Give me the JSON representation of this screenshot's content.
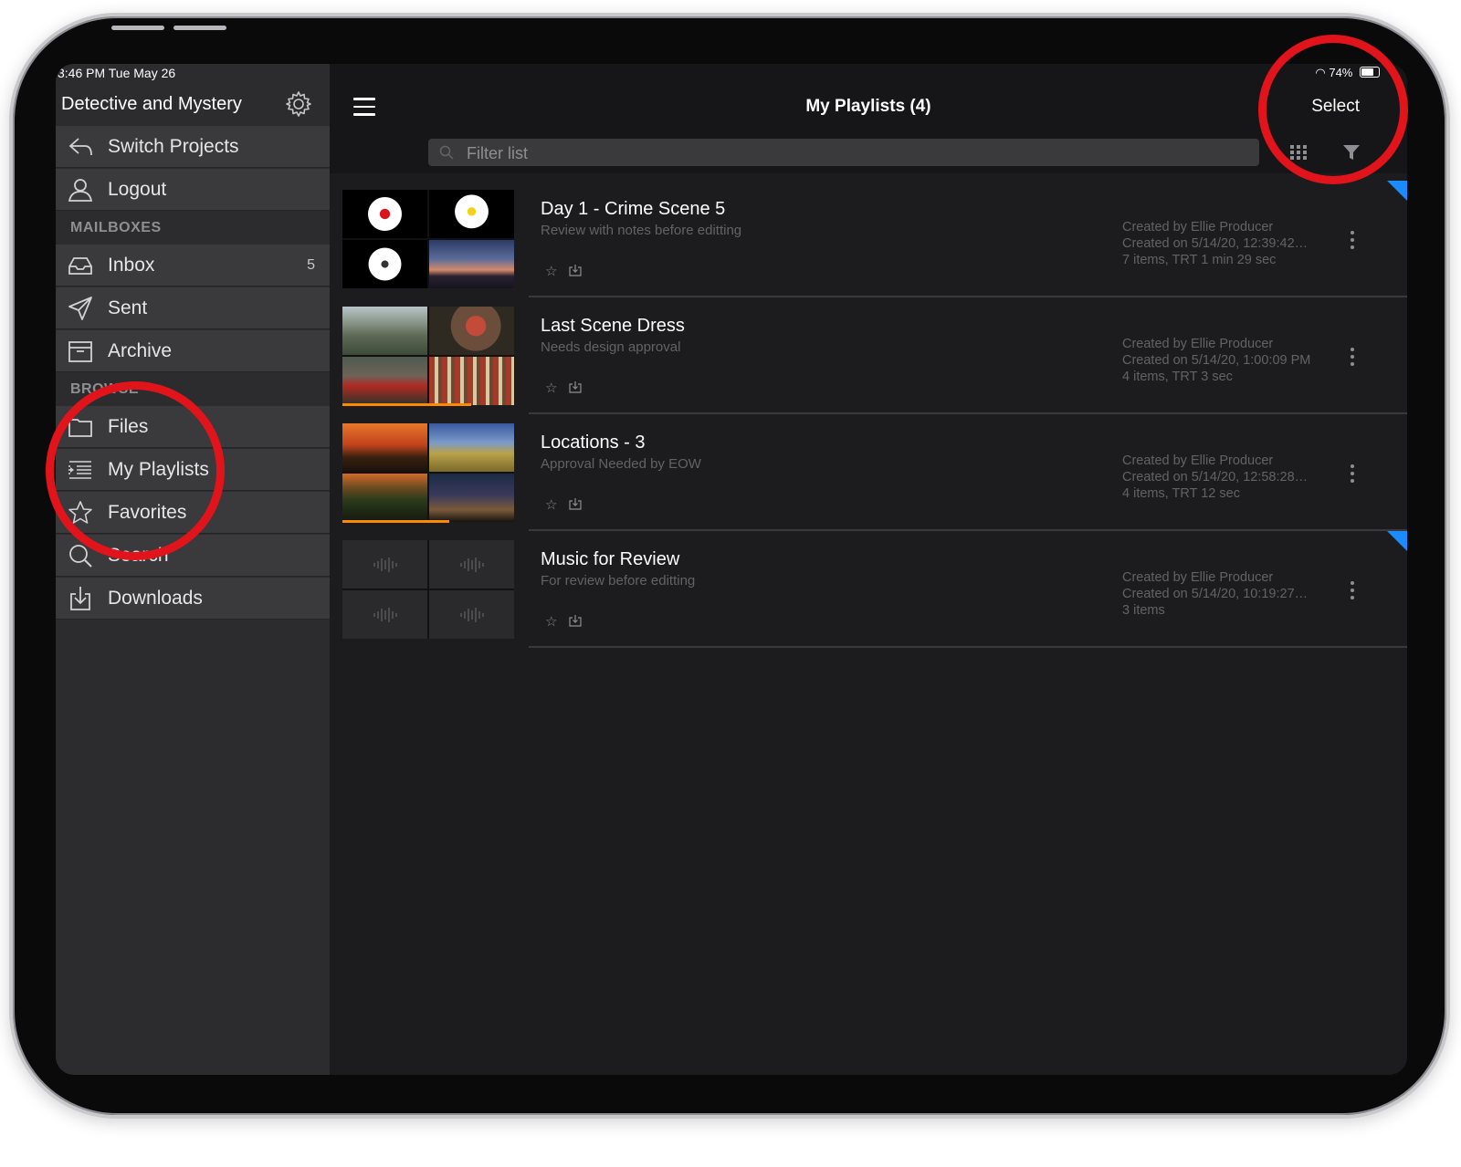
{
  "status_bar": {
    "time": "3:46 PM   Tue May 26",
    "battery": "74%"
  },
  "sidebar": {
    "project_title": "Detective and Mystery",
    "switch_projects": "Switch Projects",
    "logout": "Logout",
    "mailboxes_header": "MAILBOXES",
    "inbox": {
      "label": "Inbox",
      "count": "5"
    },
    "sent": "Sent",
    "archive": "Archive",
    "browse_header": "BROWSE",
    "files": "Files",
    "my_playlists": "My Playlists",
    "favorites": "Favorites",
    "search": "Search",
    "downloads": "Downloads"
  },
  "header": {
    "title": "My Playlists (4)",
    "select_label": "Select",
    "filter_placeholder": "Filter list"
  },
  "playlists": [
    {
      "title": "Day 1 - Crime Scene 5",
      "description": "Review with notes before editting",
      "created_by": "Created by Ellie Producer",
      "created_on": "Created on 5/14/20, 12:39:42…",
      "summary": "7 items, TRT 1 min 29 sec",
      "flagged": true
    },
    {
      "title": "Last Scene Dress",
      "description": "Needs design approval",
      "created_by": "Created by Ellie Producer",
      "created_on": "Created on 5/14/20, 1:00:09 PM",
      "summary": "4 items, TRT 3 sec",
      "progress": 0.75,
      "flagged": false
    },
    {
      "title": "Locations - 3",
      "description": "Approval Needed by EOW",
      "created_by": "Created by Ellie Producer",
      "created_on": "Created on 5/14/20, 12:58:28…",
      "summary": "4 items, TRT 12 sec",
      "progress": 0.62,
      "flagged": false
    },
    {
      "title": "Music for Review",
      "description": "For review before editting",
      "created_by": "Created by Ellie Producer",
      "created_on": "Created on 5/14/20, 10:19:27…",
      "summary": "3 items",
      "flagged": true
    }
  ],
  "colors": {
    "accent_flag": "#1a8cff",
    "progress": "#ff8a00",
    "annotation": "#e0141a"
  }
}
